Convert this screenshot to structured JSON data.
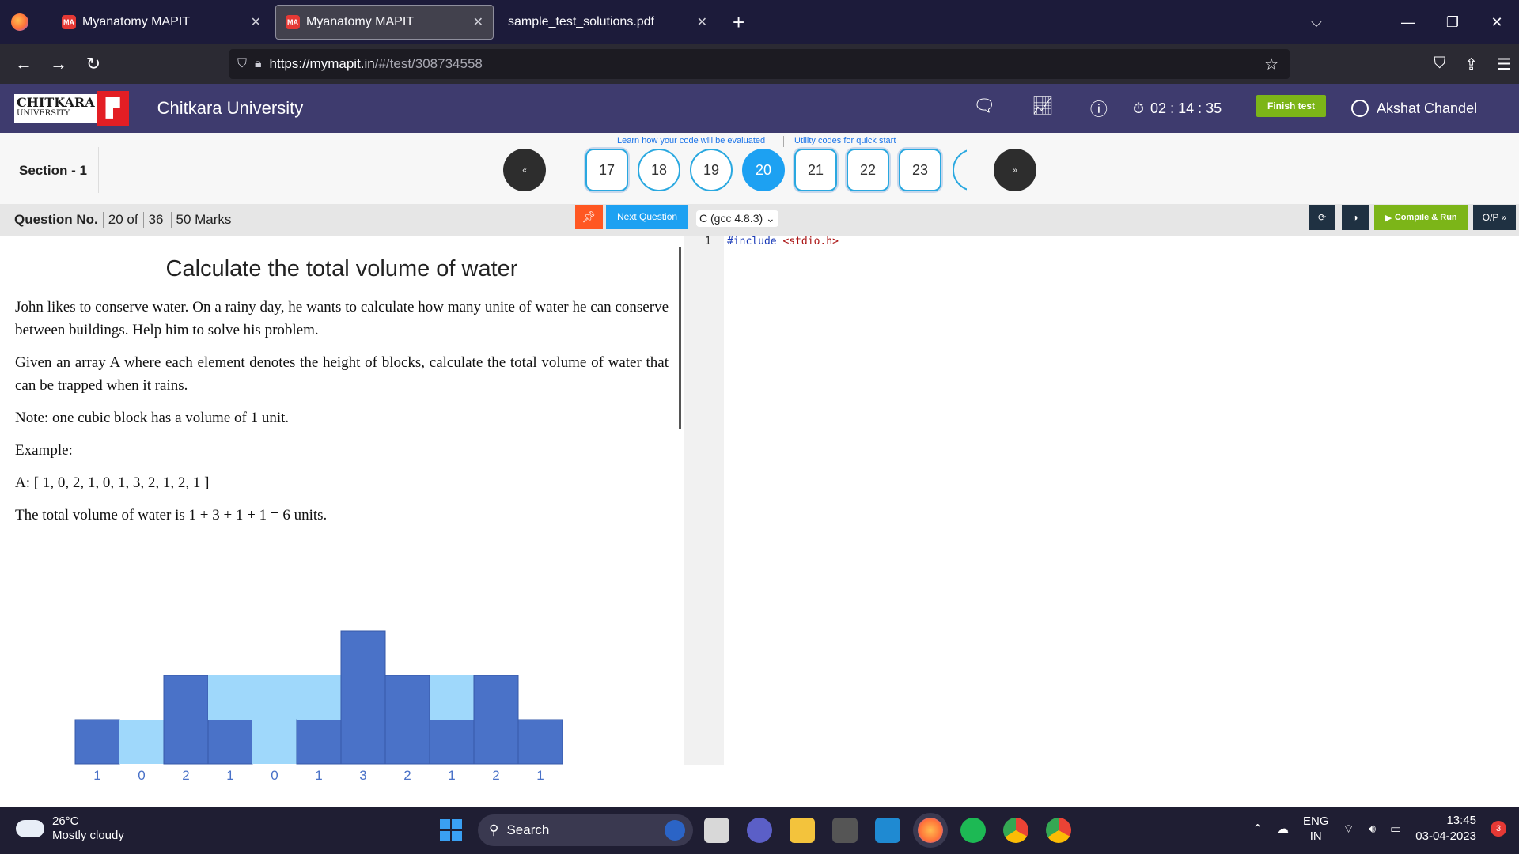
{
  "browser": {
    "tabs": [
      {
        "label": "Myanatomy MAPIT",
        "favicon": "MA"
      },
      {
        "label": "Myanatomy MAPIT",
        "favicon": "MA"
      },
      {
        "label": "sample_test_solutions.pdf",
        "favicon": ""
      }
    ],
    "url_host": "https://mymapit.in",
    "url_path": "/#/test/308734558"
  },
  "header": {
    "logo_main": "CHITKARA",
    "logo_sub": "UNIVERSITY",
    "university": "Chitkara University",
    "timer": "02 : 14 : 35",
    "finish_label": "Finish test",
    "user_name": "Akshat Chandel"
  },
  "qnav": {
    "section_label": "Section - 1",
    "help_link_1": "Learn how your code will be evaluated",
    "help_link_2": "Utility codes for quick start",
    "prev_label": "«",
    "next_label": "»",
    "questions": [
      "17",
      "18",
      "19",
      "20",
      "21",
      "22",
      "23"
    ],
    "selected": "20"
  },
  "toolbar": {
    "question_no_label": "Question No.",
    "question_of": "20 of",
    "total_questions": "36",
    "marks": "50 Marks",
    "next_question": "Next Question",
    "language": "C (gcc 4.8.3)",
    "compile_run": "Compile & Run",
    "output_label": "O/P »"
  },
  "question": {
    "title": "Calculate the total volume of water",
    "paragraphs": [
      "John likes to conserve water. On a rainy day, he wants to calculate how many unite of water he can conserve between buildings. Help him to solve his problem.",
      "Given an array A where each element denotes the height of blocks, calculate the total volume of water that can be trapped when it rains.",
      "Note: one cubic block has a volume of 1 unit.",
      "Example:",
      "A: [ 1, 0, 2, 1, 0, 1, 3, 2, 1, 2, 1 ]",
      "The total volume of water is 1 + 3 + 1 + 1 = 6 units."
    ]
  },
  "chart_data": {
    "type": "bar",
    "categories": [
      "1",
      "0",
      "2",
      "1",
      "0",
      "1",
      "3",
      "2",
      "1",
      "2",
      "1"
    ],
    "values": [
      1,
      0,
      2,
      1,
      0,
      1,
      3,
      2,
      1,
      2,
      1
    ],
    "water": [
      0,
      1,
      0,
      1,
      2,
      1,
      0,
      0,
      1,
      0,
      0
    ],
    "ylim": [
      0,
      3
    ],
    "colors": {
      "block": "#4a72c8",
      "water": "#9fd8fb",
      "label": "#4a72c8"
    }
  },
  "editor": {
    "line_number": "1",
    "code_keyword": "#include",
    "code_header": "<stdio.h>"
  },
  "taskbar": {
    "temperature": "26°C",
    "weather": "Mostly cloudy",
    "search": "Search",
    "lang_1": "ENG",
    "lang_2": "IN",
    "time": "13:45",
    "date": "03-04-2023",
    "notifications": "3"
  }
}
